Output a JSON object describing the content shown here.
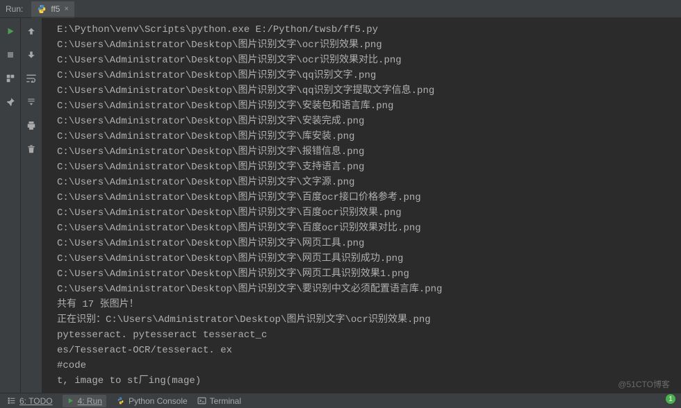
{
  "top": {
    "label": "Run:",
    "tab_name": "ff5",
    "close_glyph": "×"
  },
  "left_rail_icons": [
    "play",
    "stop",
    "layout",
    "pin"
  ],
  "left_rail2_icons": [
    "up",
    "down",
    "wrap",
    "step",
    "print",
    "trash"
  ],
  "console_lines": [
    "E:\\Python\\venv\\Scripts\\python.exe E:/Python/twsb/ff5.py",
    "C:\\Users\\Administrator\\Desktop\\图片识别文字\\ocr识别效果.png",
    "C:\\Users\\Administrator\\Desktop\\图片识别文字\\ocr识别效果对比.png",
    "C:\\Users\\Administrator\\Desktop\\图片识别文字\\qq识别文字.png",
    "C:\\Users\\Administrator\\Desktop\\图片识别文字\\qq识别文字提取文字信息.png",
    "C:\\Users\\Administrator\\Desktop\\图片识别文字\\安装包和语言库.png",
    "C:\\Users\\Administrator\\Desktop\\图片识别文字\\安装完成.png",
    "C:\\Users\\Administrator\\Desktop\\图片识别文字\\库安装.png",
    "C:\\Users\\Administrator\\Desktop\\图片识别文字\\报错信息.png",
    "C:\\Users\\Administrator\\Desktop\\图片识别文字\\支持语言.png",
    "C:\\Users\\Administrator\\Desktop\\图片识别文字\\文字源.png",
    "C:\\Users\\Administrator\\Desktop\\图片识别文字\\百度ocr接口价格参考.png",
    "C:\\Users\\Administrator\\Desktop\\图片识别文字\\百度ocr识别效果.png",
    "C:\\Users\\Administrator\\Desktop\\图片识别文字\\百度ocr识别效果对比.png",
    "C:\\Users\\Administrator\\Desktop\\图片识别文字\\网页工具.png",
    "C:\\Users\\Administrator\\Desktop\\图片识别文字\\网页工具识别成功.png",
    "C:\\Users\\Administrator\\Desktop\\图片识别文字\\网页工具识别效果1.png",
    "C:\\Users\\Administrator\\Desktop\\图片识别文字\\要识别中文必须配置语言库.png",
    "共有 17 张图片！",
    "正在识别：C:\\Users\\Administrator\\Desktop\\图片识别文字\\ocr识别效果.png",
    "pytesseract. pytesseract tesseract_c",
    "es/Tesseract-OCR/tesseract. ex",
    "#code",
    "t, image to st厂ing(mage)"
  ],
  "bottom": {
    "todo": "6: TODO",
    "run": "4: Run",
    "python_console": "Python Console",
    "terminal": "Terminal"
  },
  "badge_text": "1",
  "watermark": "@51CTO博客"
}
